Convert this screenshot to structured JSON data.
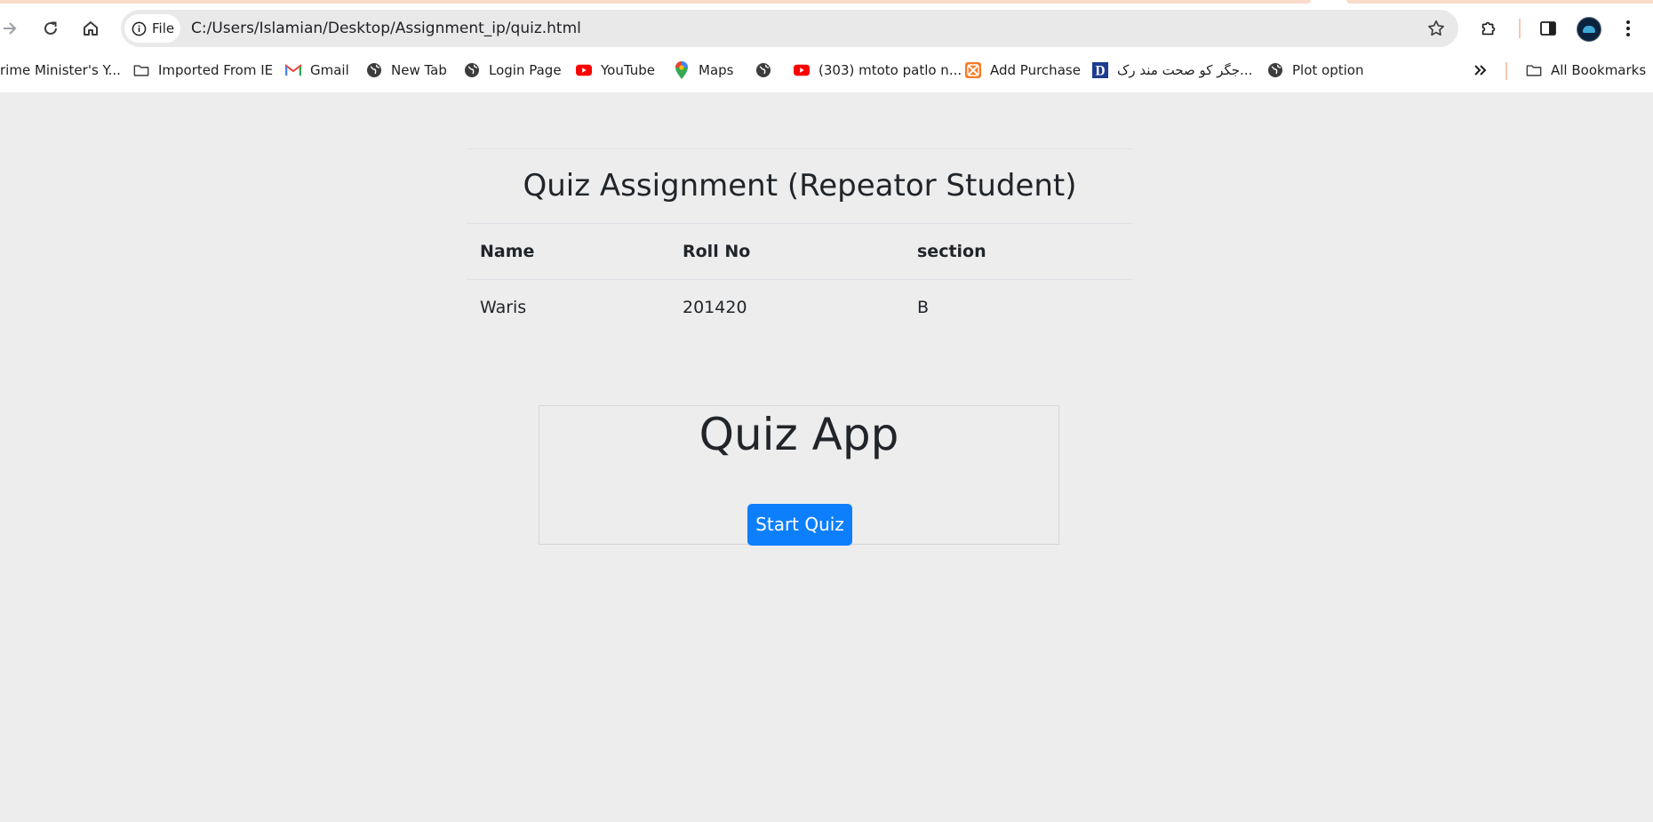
{
  "browser": {
    "address": {
      "chip_label": "File",
      "url": "C:/Users/Islamian/Desktop/Assignment_ip/quiz.html"
    },
    "icons": [
      "forward-icon",
      "reload-icon",
      "home-icon",
      "info-icon",
      "star-icon",
      "extensions-icon",
      "side-panel-icon",
      "profile-avatar",
      "menu-icon"
    ],
    "bookmarks": [
      {
        "label": "rime Minister's Y...",
        "icon": "none"
      },
      {
        "label": "Imported From IE",
        "icon": "folder-icon"
      },
      {
        "label": "Gmail",
        "icon": "gmail-icon"
      },
      {
        "label": "New Tab",
        "icon": "globe-icon"
      },
      {
        "label": "Login Page",
        "icon": "globe-icon"
      },
      {
        "label": "YouTube",
        "icon": "youtube-icon"
      },
      {
        "label": "Maps",
        "icon": "maps-icon"
      },
      {
        "label": "",
        "icon": "globe-icon"
      },
      {
        "label": "(303) mtoto patlo n...",
        "icon": "youtube-icon"
      },
      {
        "label": "Add Purchase",
        "icon": "xampp-icon"
      },
      {
        "label": "جگر کو صحت مند رک...",
        "icon": "d-icon"
      },
      {
        "label": "Plot option",
        "icon": "globe-icon"
      }
    ],
    "all_bookmarks_label": "All Bookmarks",
    "colors": {
      "youtube": "#ff0000",
      "gmail_red": "#ea4335",
      "accent": "#f9dccb"
    }
  },
  "page": {
    "caption": "Quiz Assignment (Repeator Student)",
    "table": {
      "headers": [
        "Name",
        "Roll No",
        "section"
      ],
      "rows": [
        [
          "Waris",
          "201420",
          "B"
        ]
      ]
    },
    "quiz": {
      "title": "Quiz App",
      "start_label": "Start Quiz",
      "button_color": "#0d7ffd"
    }
  }
}
